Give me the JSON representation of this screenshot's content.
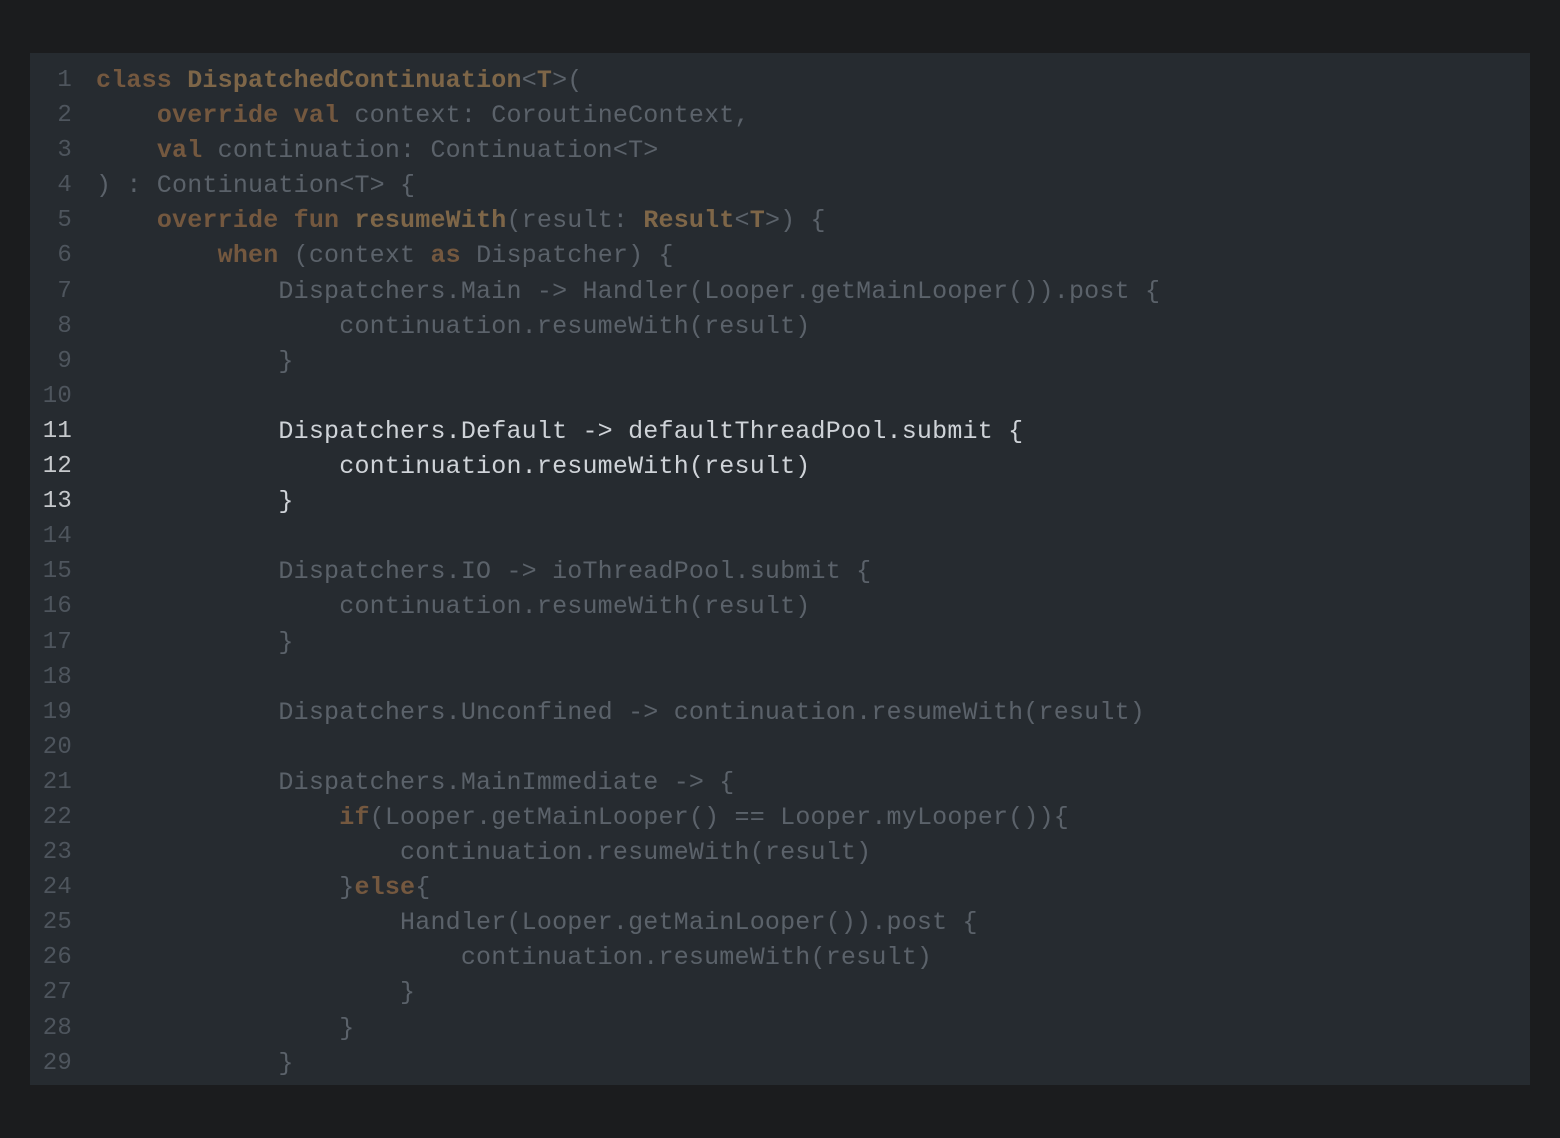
{
  "editor": {
    "language": "Kotlin",
    "colors": {
      "background": "#262b30",
      "frame": "#1b1c1e",
      "dim_text": "#5b626a",
      "keyword": "#74583f",
      "highlight_text": "#cfd3d8"
    },
    "highlighted_lines": [
      11,
      12,
      13
    ],
    "lines": [
      {
        "n": "1",
        "segments": [
          {
            "t": "class ",
            "c": "kw"
          },
          {
            "t": "DispatchedContinuation",
            "c": "fn"
          },
          {
            "t": "<",
            "c": "p"
          },
          {
            "t": "T",
            "c": "fn"
          },
          {
            "t": ">(",
            "c": "p"
          }
        ]
      },
      {
        "n": "2",
        "segments": [
          {
            "t": "    ",
            "c": "p"
          },
          {
            "t": "override val",
            "c": "kw"
          },
          {
            "t": " context: CoroutineContext,",
            "c": "p"
          }
        ]
      },
      {
        "n": "3",
        "segments": [
          {
            "t": "    ",
            "c": "p"
          },
          {
            "t": "val",
            "c": "kw"
          },
          {
            "t": " continuation: Continuation<T>",
            "c": "p"
          }
        ]
      },
      {
        "n": "4",
        "segments": [
          {
            "t": ") : Continuation<T> {",
            "c": "p"
          }
        ]
      },
      {
        "n": "5",
        "segments": [
          {
            "t": "    ",
            "c": "p"
          },
          {
            "t": "override fun ",
            "c": "kw"
          },
          {
            "t": "resumeWith",
            "c": "fn"
          },
          {
            "t": "(result: ",
            "c": "p"
          },
          {
            "t": "Result",
            "c": "fn"
          },
          {
            "t": "<",
            "c": "p"
          },
          {
            "t": "T",
            "c": "fn"
          },
          {
            "t": ">) {",
            "c": "p"
          }
        ]
      },
      {
        "n": "6",
        "segments": [
          {
            "t": "        ",
            "c": "p"
          },
          {
            "t": "when",
            "c": "kw"
          },
          {
            "t": " (context ",
            "c": "p"
          },
          {
            "t": "as",
            "c": "kw"
          },
          {
            "t": " Dispatcher) {",
            "c": "p"
          }
        ]
      },
      {
        "n": "7",
        "segments": [
          {
            "t": "            Dispatchers.Main -> Handler(Looper.getMainLooper()).post {",
            "c": "p"
          }
        ]
      },
      {
        "n": "8",
        "segments": [
          {
            "t": "                continuation.resumeWith(result)",
            "c": "p"
          }
        ]
      },
      {
        "n": "9",
        "segments": [
          {
            "t": "            }",
            "c": "p"
          }
        ]
      },
      {
        "n": "10",
        "segments": [
          {
            "t": "",
            "c": "p"
          }
        ]
      },
      {
        "n": "11",
        "segments": [
          {
            "t": "            Dispatchers.Default -> defaultThreadPool.submit {",
            "c": "p"
          }
        ]
      },
      {
        "n": "12",
        "segments": [
          {
            "t": "                continuation.resumeWith(result)",
            "c": "p"
          }
        ]
      },
      {
        "n": "13",
        "segments": [
          {
            "t": "            }",
            "c": "p"
          }
        ]
      },
      {
        "n": "14",
        "segments": [
          {
            "t": "",
            "c": "p"
          }
        ]
      },
      {
        "n": "15",
        "segments": [
          {
            "t": "            Dispatchers.IO -> ioThreadPool.submit {",
            "c": "p"
          }
        ]
      },
      {
        "n": "16",
        "segments": [
          {
            "t": "                continuation.resumeWith(result)",
            "c": "p"
          }
        ]
      },
      {
        "n": "17",
        "segments": [
          {
            "t": "            }",
            "c": "p"
          }
        ]
      },
      {
        "n": "18",
        "segments": [
          {
            "t": "",
            "c": "p"
          }
        ]
      },
      {
        "n": "19",
        "segments": [
          {
            "t": "            Dispatchers.Unconfined -> continuation.resumeWith(result)",
            "c": "p"
          }
        ]
      },
      {
        "n": "20",
        "segments": [
          {
            "t": "",
            "c": "p"
          }
        ]
      },
      {
        "n": "21",
        "segments": [
          {
            "t": "            Dispatchers.MainImmediate -> {",
            "c": "p"
          }
        ]
      },
      {
        "n": "22",
        "segments": [
          {
            "t": "                ",
            "c": "p"
          },
          {
            "t": "if",
            "c": "kw"
          },
          {
            "t": "(Looper.getMainLooper() == Looper.myLooper()){",
            "c": "p"
          }
        ]
      },
      {
        "n": "23",
        "segments": [
          {
            "t": "                    continuation.resumeWith(result)",
            "c": "p"
          }
        ]
      },
      {
        "n": "24",
        "segments": [
          {
            "t": "                }",
            "c": "p"
          },
          {
            "t": "else",
            "c": "kw"
          },
          {
            "t": "{",
            "c": "p"
          }
        ]
      },
      {
        "n": "25",
        "segments": [
          {
            "t": "                    Handler(Looper.getMainLooper()).post {",
            "c": "p"
          }
        ]
      },
      {
        "n": "26",
        "segments": [
          {
            "t": "                        continuation.resumeWith(result)",
            "c": "p"
          }
        ]
      },
      {
        "n": "27",
        "segments": [
          {
            "t": "                    }",
            "c": "p"
          }
        ]
      },
      {
        "n": "28",
        "segments": [
          {
            "t": "                }",
            "c": "p"
          }
        ]
      },
      {
        "n": "29",
        "segments": [
          {
            "t": "            }",
            "c": "p"
          }
        ]
      }
    ]
  }
}
